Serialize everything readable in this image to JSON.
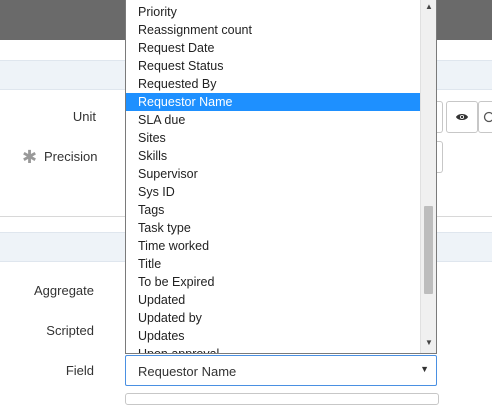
{
  "form": {
    "unit_label": "Unit",
    "precision_label": "Precision",
    "aggregate_label": "Aggregate",
    "scripted_label": "Scripted",
    "field_label": "Field",
    "required_marker": "✱"
  },
  "field_select": {
    "selected_value": "Requestor Name",
    "options": [
      "Priority",
      "Reassignment count",
      "Request Date",
      "Request Status",
      "Requested By",
      "Requestor Name",
      "SLA due",
      "Sites",
      "Skills",
      "Supervisor",
      "Sys ID",
      "Tags",
      "Task type",
      "Time worked",
      "Title",
      "To be Expired",
      "Updated",
      "Updated by",
      "Updates",
      "Upon approval"
    ],
    "highlighted_index": 5
  },
  "icons": {
    "preview": "eye-icon",
    "caret": "chevron-down-icon",
    "scroll_up": "scroll-up-arrow-icon",
    "scroll_down": "scroll-down-arrow-icon"
  },
  "colors": {
    "highlight": "#1e90ff",
    "header": "#6a6a6a",
    "section_band": "#eef3f8"
  }
}
